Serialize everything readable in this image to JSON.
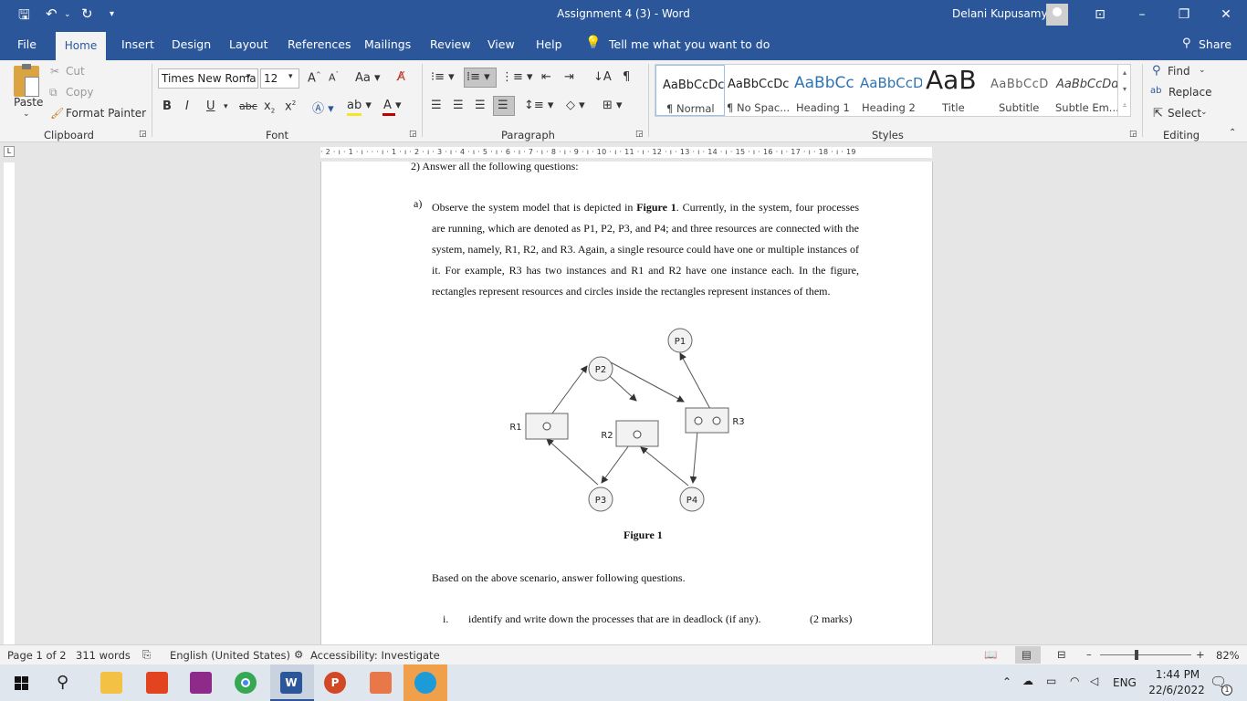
{
  "window": {
    "title": "Assignment 4 (3)  -  Word",
    "user": "Delani Kupusamy"
  },
  "menu": {
    "tabs": [
      "File",
      "Home",
      "Insert",
      "Design",
      "Layout",
      "References",
      "Mailings",
      "Review",
      "View",
      "Help"
    ],
    "tell_me": "Tell me what you want to do",
    "share": "Share"
  },
  "ribbon": {
    "clipboard": {
      "label": "Clipboard",
      "paste": "Paste",
      "cut": "Cut",
      "copy": "Copy",
      "format_painter": "Format Painter"
    },
    "font": {
      "label": "Font",
      "name": "Times New Roma",
      "size": "12"
    },
    "paragraph": {
      "label": "Paragraph"
    },
    "styles": {
      "label": "Styles",
      "items": [
        {
          "preview": "AaBbCcDc",
          "name": "¶ Normal"
        },
        {
          "preview": "AaBbCcDc",
          "name": "¶ No Spac..."
        },
        {
          "preview": "AaBbCc",
          "name": "Heading 1"
        },
        {
          "preview": "AaBbCcD",
          "name": "Heading 2"
        },
        {
          "preview": "AaB",
          "name": "Title"
        },
        {
          "preview": "AaBbCcD",
          "name": "Subtitle"
        },
        {
          "preview": "AaBbCcDd",
          "name": "Subtle Em..."
        }
      ]
    },
    "editing": {
      "label": "Editing",
      "find": "Find",
      "replace": "Replace",
      "select": "Select"
    }
  },
  "ruler": {
    "text": "· 2 · ı · 1 · ı · · · ı · 1 · ı · 2 · ı · 3 · ı · 4 · ı · 5 · ı · 6 · ı · 7 · ı · 8 · ı · 9 · ı · 10 · ı · 11 · ı · 12 · ı · 13 · ı · 14 · ı · 15 · ı · 16 · ı · 17 · ı · 18 · ı · 19"
  },
  "document": {
    "q2_partial": "2)   Answer all the following questions:",
    "a_label": "a)",
    "para_a": [
      {
        "text": "Observe the system model that is depicted in "
      },
      {
        "text": "Figure 1",
        "bold": true
      },
      {
        "text": ". Currently, in the system, four processes are running, which are denoted as P1, P2, P3, and P4; and three resources are connected with the system, namely, R1, R2, and R3. Again, a single resource could have one or multiple instances of it. For example, R3 has two instances and R1 and R2 have one instance each. In the figure, rectangles represent resources and circles inside the rectangles represent instances of them."
      }
    ],
    "figure": {
      "processes": [
        "P1",
        "P2",
        "P3",
        "P4"
      ],
      "resources": [
        "R1",
        "R2",
        "R3"
      ],
      "caption": "Figure 1"
    },
    "based_on": "Based on the above scenario, answer following questions.",
    "q_i": {
      "num": "i.",
      "text": "identify and write down the processes that are in deadlock (if any).",
      "marks": "(2 marks)"
    }
  },
  "status": {
    "page": "Page 1 of 2",
    "words": "311 words",
    "language": "English (United States)",
    "accessibility": "Accessibility: Investigate",
    "zoom": "82%"
  },
  "taskbar": {
    "time": "1:44 PM",
    "date": "22/6/2022",
    "lang": "ENG",
    "notifications": "1"
  }
}
